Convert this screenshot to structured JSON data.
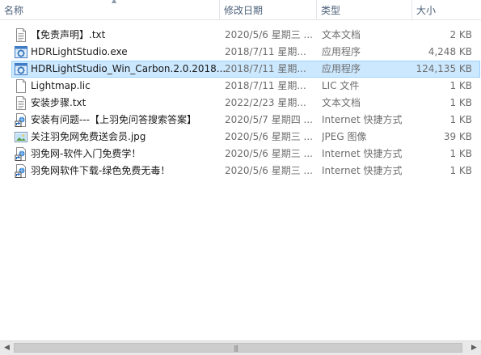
{
  "columns": {
    "name": "名称",
    "date": "修改日期",
    "type": "类型",
    "size": "大小"
  },
  "files": [
    {
      "name": "【免责声明】.txt",
      "date": "2020/5/6 星期三 ...",
      "type": "文本文档",
      "size": "2 KB",
      "icon": "text-file-icon"
    },
    {
      "name": "HDRLightStudio.exe",
      "date": "2018/7/11 星期...",
      "type": "应用程序",
      "size": "4,248 KB",
      "icon": "app-icon"
    },
    {
      "name": "HDRLightStudio_Win_Carbon.2.0.2018...",
      "date": "2018/7/11 星期...",
      "type": "应用程序",
      "size": "124,135 KB",
      "icon": "app-icon",
      "selected": true
    },
    {
      "name": "Lightmap.lic",
      "date": "2018/7/11 星期...",
      "type": "LIC 文件",
      "size": "1 KB",
      "icon": "blank-file-icon"
    },
    {
      "name": "安装步骤.txt",
      "date": "2022/2/23 星期...",
      "type": "文本文档",
      "size": "1 KB",
      "icon": "text-file-icon"
    },
    {
      "name": "安装有问题---【上羽免问答搜索答案】",
      "date": "2020/5/7 星期四 ...",
      "type": "Internet 快捷方式",
      "size": "1 KB",
      "icon": "shortcut-icon"
    },
    {
      "name": "关注羽免网免费送会员.jpg",
      "date": "2020/5/6 星期三 ...",
      "type": "JPEG 图像",
      "size": "39 KB",
      "icon": "image-file-icon"
    },
    {
      "name": "羽免网-软件入门免费学！",
      "date": "2020/5/6 星期三 ...",
      "type": "Internet 快捷方式",
      "size": "1 KB",
      "icon": "shortcut-icon"
    },
    {
      "name": "羽免网软件下载-绿色免费无毒！",
      "date": "2020/5/6 星期三 ...",
      "type": "Internet 快捷方式",
      "size": "1 KB",
      "icon": "shortcut-icon"
    }
  ],
  "colors": {
    "selection_bg": "#cce8ff",
    "selection_border": "#99d1ff",
    "header_text": "#4c607a",
    "detail_text": "#6d6d6d"
  }
}
